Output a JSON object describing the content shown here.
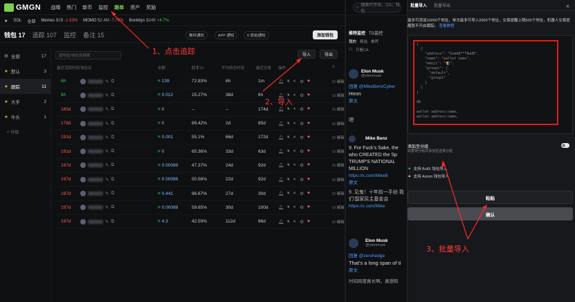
{
  "app": {
    "logo": "GMGN"
  },
  "nav": [
    "战壕",
    "热门",
    "新币",
    "监控",
    "跟单",
    "资产",
    "奖励"
  ],
  "nav_active_index": 4,
  "search": {
    "placeholder": "搜索代币名、CA、钱包"
  },
  "ticker": {
    "left": [
      "★",
      "SOL",
      "全部"
    ],
    "items": [
      {
        "name": "Memes",
        "val": "$2B",
        "chg": "-1.53%",
        "dir": "neg"
      },
      {
        "name": "MOMO",
        "val": "$2.4M",
        "chg": "-7.79%",
        "dir": "neg"
      },
      {
        "name": "Bonkbys",
        "val": "$24K",
        "chg": "+4.7%",
        "dir": "pos"
      }
    ]
  },
  "header": {
    "tabs": [
      "钱包 17",
      "追踪 107",
      "监控",
      "备注 15"
    ],
    "chips": [
      "推特通知",
      "APP 通知",
      "0 原始通知"
    ],
    "add_wallet": "添加钱包"
  },
  "groups": [
    {
      "name": "全部",
      "count": "17",
      "star": false
    },
    {
      "name": "默认",
      "count": "3",
      "star": true
    },
    {
      "name": "跟踪",
      "count": "11",
      "star": true,
      "active": true
    },
    {
      "name": "大手",
      "count": "2",
      "star": true
    },
    {
      "name": "牛头",
      "count": "1",
      "star": true
    }
  ],
  "add_group": "+ 分组",
  "filter": {
    "placeholder": "按地址/钱包名搜索"
  },
  "buttons": {
    "import": "导入",
    "export": "导出"
  },
  "columns": [
    "最近活跃时间",
    "钱包名",
    "余额",
    "胜率7d",
    "平均持仓时间",
    "最近交易",
    "操作",
    "X"
  ],
  "rows": [
    {
      "time": "8h",
      "tc": "g",
      "bal": "139",
      "win": "72.83%",
      "hold": "6h",
      "last": "1m"
    },
    {
      "time": "8h",
      "tc": "g",
      "bal": "0.012",
      "win": "15.27%",
      "hold": "38d",
      "last": "6h"
    },
    {
      "time": "185d",
      "tc": "r",
      "bal": "0",
      "win": "--",
      "hold": "--",
      "last": "174d"
    },
    {
      "time": "178d",
      "tc": "r",
      "bal": "0",
      "win": "89.42%",
      "hold": "2d",
      "last": "85d"
    },
    {
      "time": "191d",
      "tc": "r",
      "bal": "0.001",
      "win": "55.1%",
      "hold": "66d",
      "last": "172d"
    },
    {
      "time": "191d",
      "tc": "r",
      "bal": "0",
      "win": "65.36%",
      "hold": "33d",
      "last": "63d"
    },
    {
      "time": "197d",
      "tc": "r",
      "bal": "0.00089",
      "win": "47.37%",
      "hold": "24d",
      "last": "92d"
    },
    {
      "time": "197d",
      "tc": "r",
      "bal": "0.00089",
      "win": "50.58%",
      "hold": "22d",
      "last": "92d"
    },
    {
      "time": "197d",
      "tc": "r",
      "bal": "0.441",
      "win": "66.67%",
      "hold": "27d",
      "last": "30d"
    },
    {
      "time": "197d",
      "tc": "r",
      "bal": "0.00089",
      "win": "59.65%",
      "hold": "30d",
      "last": "100d"
    },
    {
      "time": "197d",
      "tc": "r",
      "bal": "4.3",
      "win": "42.59%",
      "hold": "112d",
      "last": "86d"
    }
  ],
  "row_x": "编辑",
  "twitter": {
    "tabs": [
      "推特监控",
      "TG监控"
    ],
    "sub": [
      "我的",
      "精选",
      "推荐"
    ],
    "filter": "只看CA",
    "cards": [
      {
        "name": "Elon Musk",
        "handle": "@elonmusk",
        "reply": "回复 @MikeBenzCyber",
        "text": "Hmm",
        "link": "原文"
      },
      {
        "name": "Mike Benz",
        "handle": "",
        "text": "9. For Fuck's Sake, the who CREATED the Sp TRUMP'S NATIONAL MILLION",
        "link": "https://x.com/MikeB",
        "orig": "原文"
      },
      {
        "name": "Elon Musk",
        "handle": "@elonmusk",
        "reply": "回复 @zerohedge",
        "text": "That's a long span of ti",
        "link": "原文",
        "trans": "时间跨度真长啊。真想知"
      }
    ],
    "quote": "9. 见鬼！十年前一手创 我们'国家民主基金会",
    "quote_link": "https://x.com/Mike"
  },
  "panel": {
    "tabs": [
      "批量导入",
      "批量导出"
    ],
    "close": "×",
    "desc": "最多可添加10000个地址，单次最多可导入2000个地址，交易提醒上限500个地址，机器人交易提醒暂不开启跟踪。",
    "desc_link": "查看教程",
    "code": "[\n  {\n    \"address\": \"Gzmb8***BwUB\",\n    \"name\": \"wallet name\",\n    \"emoji\": \"🐒\",\n    \"groups\": [\n      \"default\",\n      \"group1\"\n    ]\n  }\n]\n\nOR\n\nwallet address:name,\nwallet address:name,",
    "toggle_label": "添加至分组",
    "toggle_sub": "如要将分组并添加至选择分组",
    "opt1": "支持 BullX 钱包导入",
    "opt2": "支持 Axiom 钱包导入",
    "paste": "粘贴",
    "confirm": "确认"
  },
  "annotations": {
    "a1": "1、点击追踪",
    "a2": "2、导入",
    "a3": "3、批量导入"
  },
  "colors": {
    "accent": "#7bd04f",
    "annotation": "#ff3b3b",
    "negative": "#ff5b5b",
    "positive": "#34c759"
  }
}
